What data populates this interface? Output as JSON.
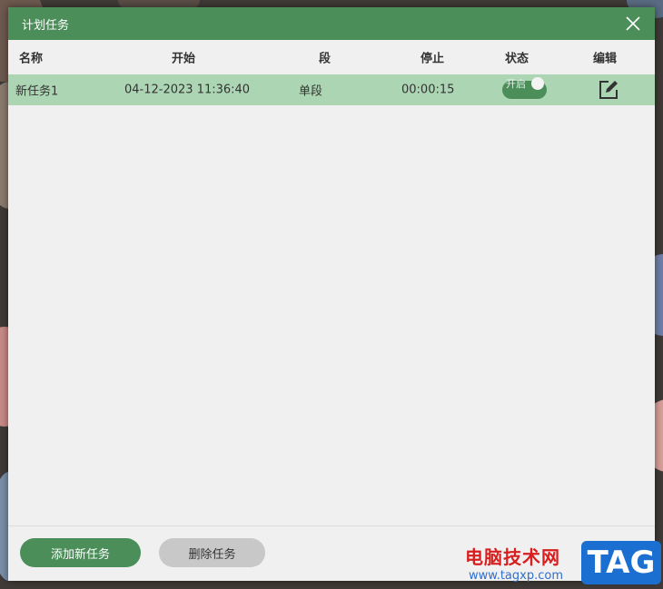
{
  "window": {
    "title": "计划任务"
  },
  "table": {
    "columns": [
      "名称",
      "开始",
      "段",
      "停止",
      "状态",
      "编辑"
    ],
    "rows": [
      {
        "name": "新任务1",
        "start": "04-12-2023 11:36:40",
        "segment": "单段",
        "stop": "00:00:15",
        "status": "开启",
        "enabled": true
      }
    ]
  },
  "footer": {
    "add_label": "添加新任务",
    "delete_label": "删除任务"
  },
  "watermark": {
    "site_name": "电脑技术网",
    "url": "www.tagxp.com",
    "logo_text": "TAG"
  },
  "colors": {
    "accent": "#4b8e5a",
    "row_selected": "#acd5b3",
    "dialog_bg": "#f0f0f0"
  },
  "icons": {
    "close": "close-icon",
    "edit": "edit-icon"
  }
}
